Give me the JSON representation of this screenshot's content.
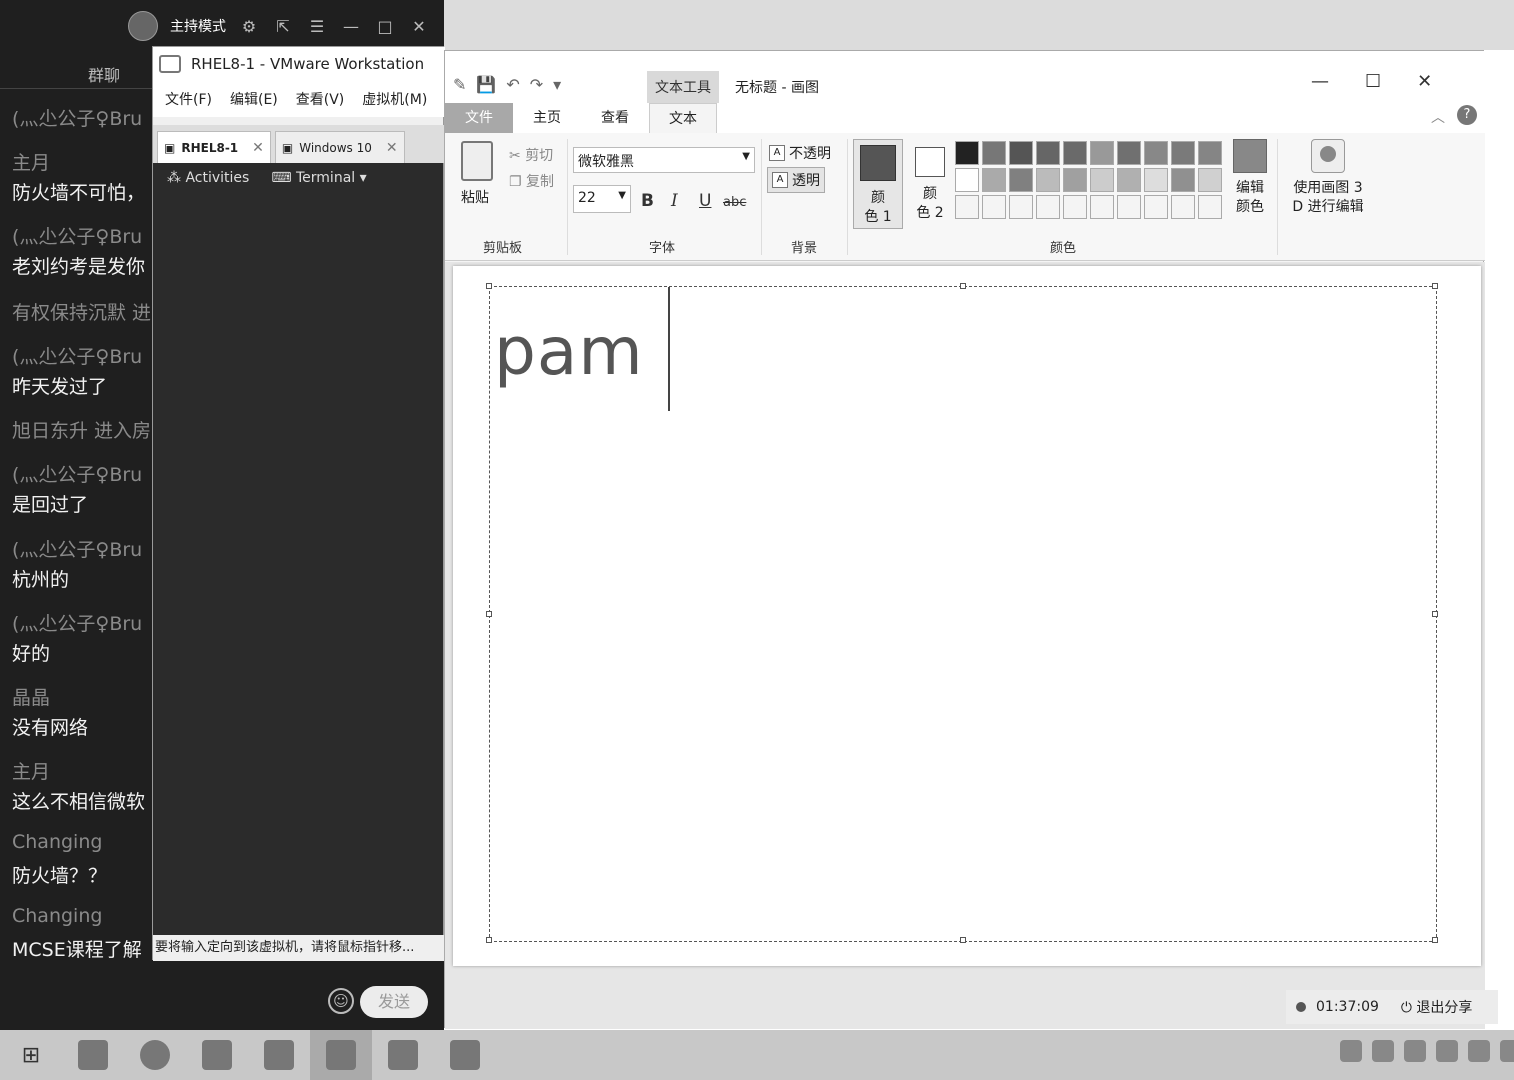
{
  "chat": {
    "host_mode": "主持模式",
    "group_tab": "群聊",
    "messages": [
      {
        "who": "(灬尐公子♀Bru",
        "text": ""
      },
      {
        "who": "主月",
        "text": "防火墙不可怕，"
      },
      {
        "who": "(灬尐公子♀Bru",
        "text": "老刘约考是发你"
      },
      {
        "system": "有权保持沉默 进"
      },
      {
        "who": "(灬尐公子♀Bru",
        "text": "昨天发过了"
      },
      {
        "system": "旭日东升 进入房"
      },
      {
        "who": "(灬尐公子♀Bru",
        "text": "是回过了"
      },
      {
        "who": "(灬尐公子♀Bru",
        "text": "杭州的"
      },
      {
        "who": "(灬尐公子♀Bru",
        "text": "好的"
      },
      {
        "who": "晶晶",
        "text": "没有网络"
      },
      {
        "who": "主月",
        "text": "这么不相信微软"
      },
      {
        "who": "Changing",
        "text": "防火墙？？"
      },
      {
        "who": "Changing",
        "text": "MCSE课程了解"
      }
    ],
    "send_label": "发送"
  },
  "vmware": {
    "title": "RHEL8-1 - VMware Workstation",
    "menu": [
      "文件(F)",
      "编辑(E)",
      "查看(V)",
      "虚拟机(M)"
    ],
    "tabs": [
      {
        "label": "RHEL8-1"
      },
      {
        "label": "Windows 10"
      }
    ],
    "activities": "Activities",
    "terminal": "Terminal ▾",
    "status": "要将输入定向到该虚拟机，请将鼠标指针移..."
  },
  "paint": {
    "context_tab": "文本工具",
    "doc_title": "无标题 - 画图",
    "tabs": {
      "file": "文件",
      "home": "主页",
      "view": "查看",
      "text": "文本"
    },
    "clipboard": {
      "paste": "粘贴",
      "cut": "剪切",
      "copy": "复制",
      "group": "剪贴板"
    },
    "font": {
      "name": "微软雅黑",
      "size": "22",
      "bold": "B",
      "italic": "I",
      "underline": "U",
      "strike": "abc",
      "group": "字体"
    },
    "background": {
      "opaque": "不透明",
      "transparent": "透明",
      "group": "背景"
    },
    "colors": {
      "color1_a": "颜",
      "color1_b": "色 1",
      "color2_a": "颜",
      "color2_b": "色 2",
      "edit_a": "编辑",
      "edit_b": "颜色",
      "paint3d_a": "使用画图 3",
      "paint3d_b": "D 进行编辑",
      "group": "颜色"
    },
    "palette_row1": [
      "#222222",
      "#777777",
      "#555555",
      "#666666",
      "#6a6a6a",
      "#999999",
      "#707070",
      "#888888",
      "#7a7a7a",
      "#858585"
    ],
    "palette_row2": [
      "#ffffff",
      "#aaaaaa",
      "#808080",
      "#bbbbbb",
      "#a0a0a0",
      "#cccccc",
      "#b0b0b0",
      "#dddddd",
      "#909090",
      "#d0d0d0"
    ],
    "palette_row3": [
      "#f4f4f4",
      "#f4f4f4",
      "#f4f4f4",
      "#f4f4f4",
      "#f4f4f4",
      "#f4f4f4",
      "#f4f4f4",
      "#f4f4f4",
      "#f4f4f4",
      "#f4f4f4"
    ],
    "canvas_text": "pam"
  },
  "share": {
    "time": "01:37:09",
    "exit": "退出分享"
  }
}
